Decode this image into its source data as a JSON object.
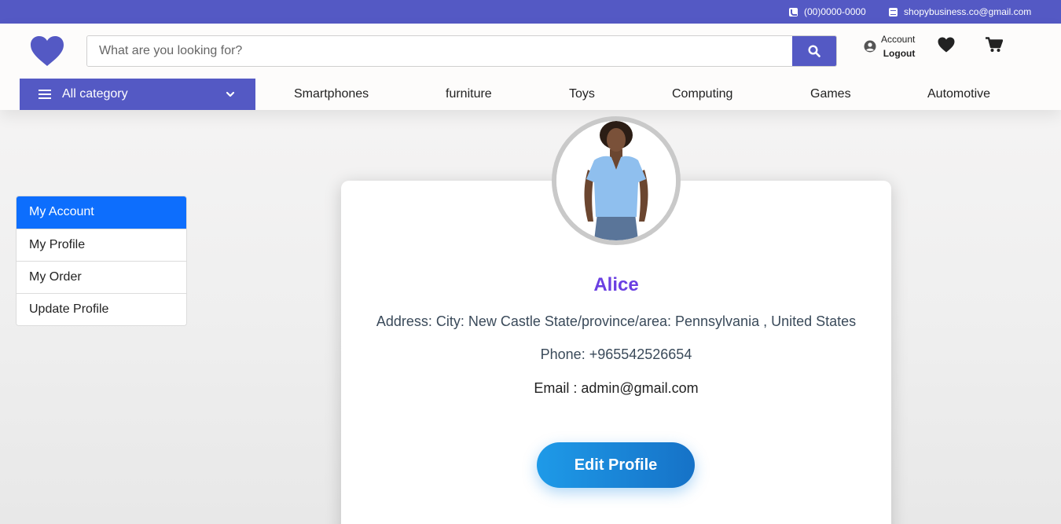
{
  "topbar": {
    "phone": "(00)0000-0000",
    "email": "shopybusiness.co@gmail.com"
  },
  "header": {
    "search_placeholder": "What are you looking for?",
    "account_label": "Account",
    "logout_label": "Logout"
  },
  "nav": {
    "all_category": "All category",
    "links": [
      "Smartphones",
      "furniture",
      "Toys",
      "Computing",
      "Games",
      "Automotive"
    ]
  },
  "sidebar": {
    "items": [
      "My Account",
      "My Profile",
      "My Order",
      "Update Profile"
    ]
  },
  "profile": {
    "name": "Alice",
    "address": "Address: City: New Castle State/province/area: Pennsylvania , United States",
    "phone": "Phone: +965542526654",
    "email": "Email : admin@gmail.com",
    "edit_button": "Edit Profile"
  },
  "colors": {
    "brand": "#5459c4",
    "active_item": "#0d6efd",
    "name": "#6a3fe2",
    "button_start": "#1e9ae8",
    "button_end": "#1672c7"
  }
}
